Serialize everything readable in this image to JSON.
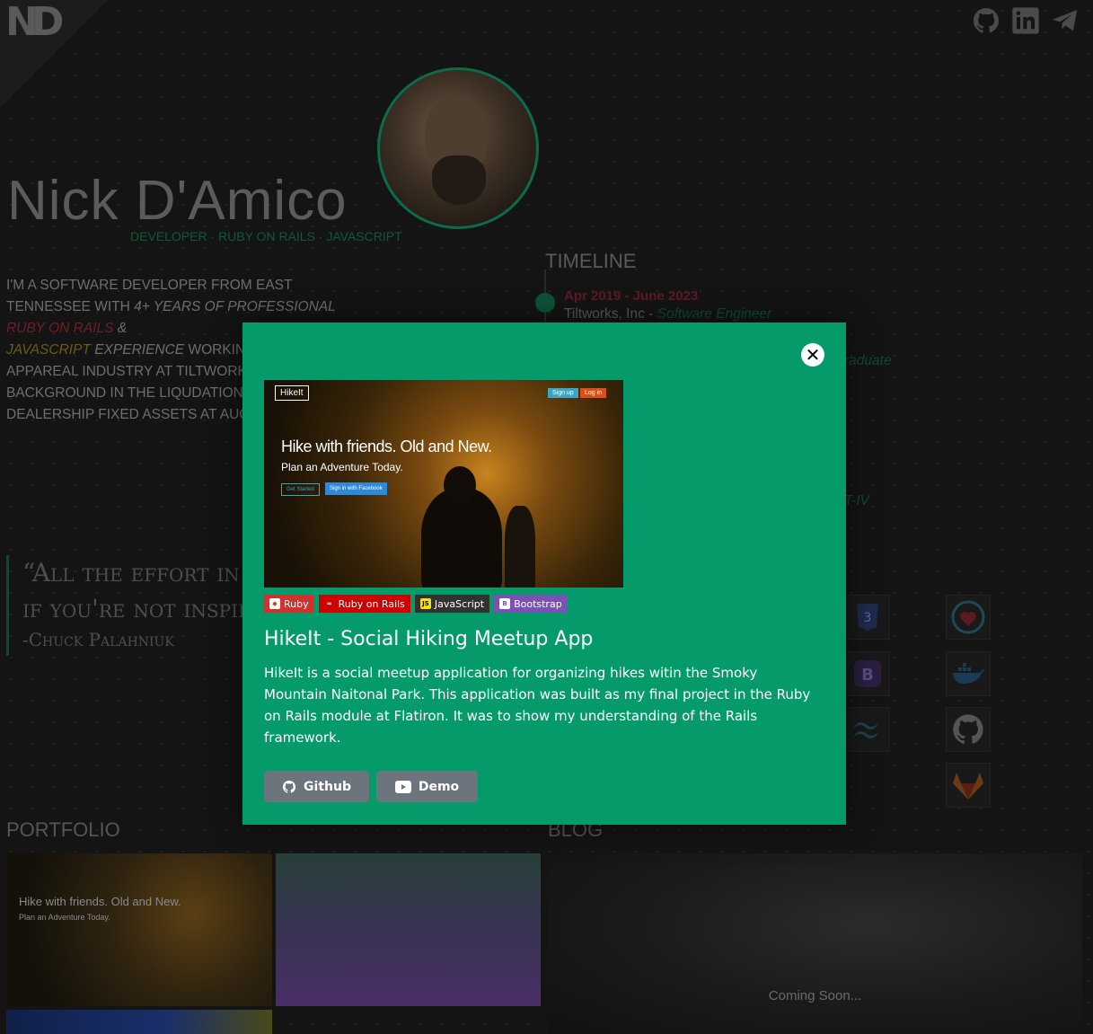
{
  "header": {
    "logo_text": "ND",
    "social": [
      "github-icon",
      "linkedin-icon",
      "telegram-icon"
    ]
  },
  "profile": {
    "name": "Nick D'Amico",
    "tagline": "DEVELOPER · RUBY ON RAILS · JAVASCRIPT"
  },
  "intro": {
    "p1": "I'M A SOFTWARE DEVELOPER FROM EAST TENNESSEE WITH ",
    "years": "4+ YEARS OF PROFESSIONAL ",
    "ror": "RUBY ON RAILS",
    "amp": " & ",
    "js": "JAVASCRIPT",
    "exp": " EXPERIENCE",
    "p2": " WORKING",
    "line3": "APPAREAL INDUSTRY AT TILTWORKS",
    "line4": "BACKGROUND IN THE LIQUDATION",
    "line5": "DEALERSHIP FIXED ASSETS AT AUCT"
  },
  "quote": {
    "text_line1": "“All the effort in the wo",
    "text_line2": "if you're not inspired.”",
    "author": "-Chuck Palahniuk"
  },
  "timeline": {
    "title": "TIMELINE",
    "entries": [
      {
        "date": "Apr 2019 - June 2023",
        "company": "Tiltworks, Inc - ",
        "role": "Software Engineer"
      }
    ],
    "fragment_1": "raduate",
    "fragment_2": "T-IV"
  },
  "sections": {
    "portfolio": "PORTFOLIO",
    "blog": "BLOG",
    "blog_placeholder": "Coming Soon..."
  },
  "portfolio_thumb": {
    "title": "Hike with friends. Old and New.",
    "sub": "Plan an Adventure Today."
  },
  "modal": {
    "close_label": "✕",
    "screenshot": {
      "logo": "HikeIt",
      "sign_up": "Sign up",
      "log_in": "Log in",
      "headline": "Hike with friends. Old and New.",
      "subline": "Plan an Adventure Today.",
      "get_started": "Get Started",
      "facebook": "Sign in with Facebook"
    },
    "badges": [
      {
        "label": "Ruby",
        "color": "#cc342d"
      },
      {
        "label": "Ruby on Rails",
        "color": "#cc0000"
      },
      {
        "label": "JavaScript",
        "color": "#323330"
      },
      {
        "label": "Bootstrap",
        "color": "#7952b3"
      }
    ],
    "title": "HikeIt - Social Hiking Meetup App",
    "description": "HikeIt is a social meetup application for organizing hikes witin the Smoky Mountain Naitonal Park. This application was built as my final project in the Ruby on Rails module at Flatiron. It was to show my understanding of the Rails framework.",
    "github_label": "Github",
    "demo_label": "Demo",
    "accent_color": "#049a6a"
  }
}
